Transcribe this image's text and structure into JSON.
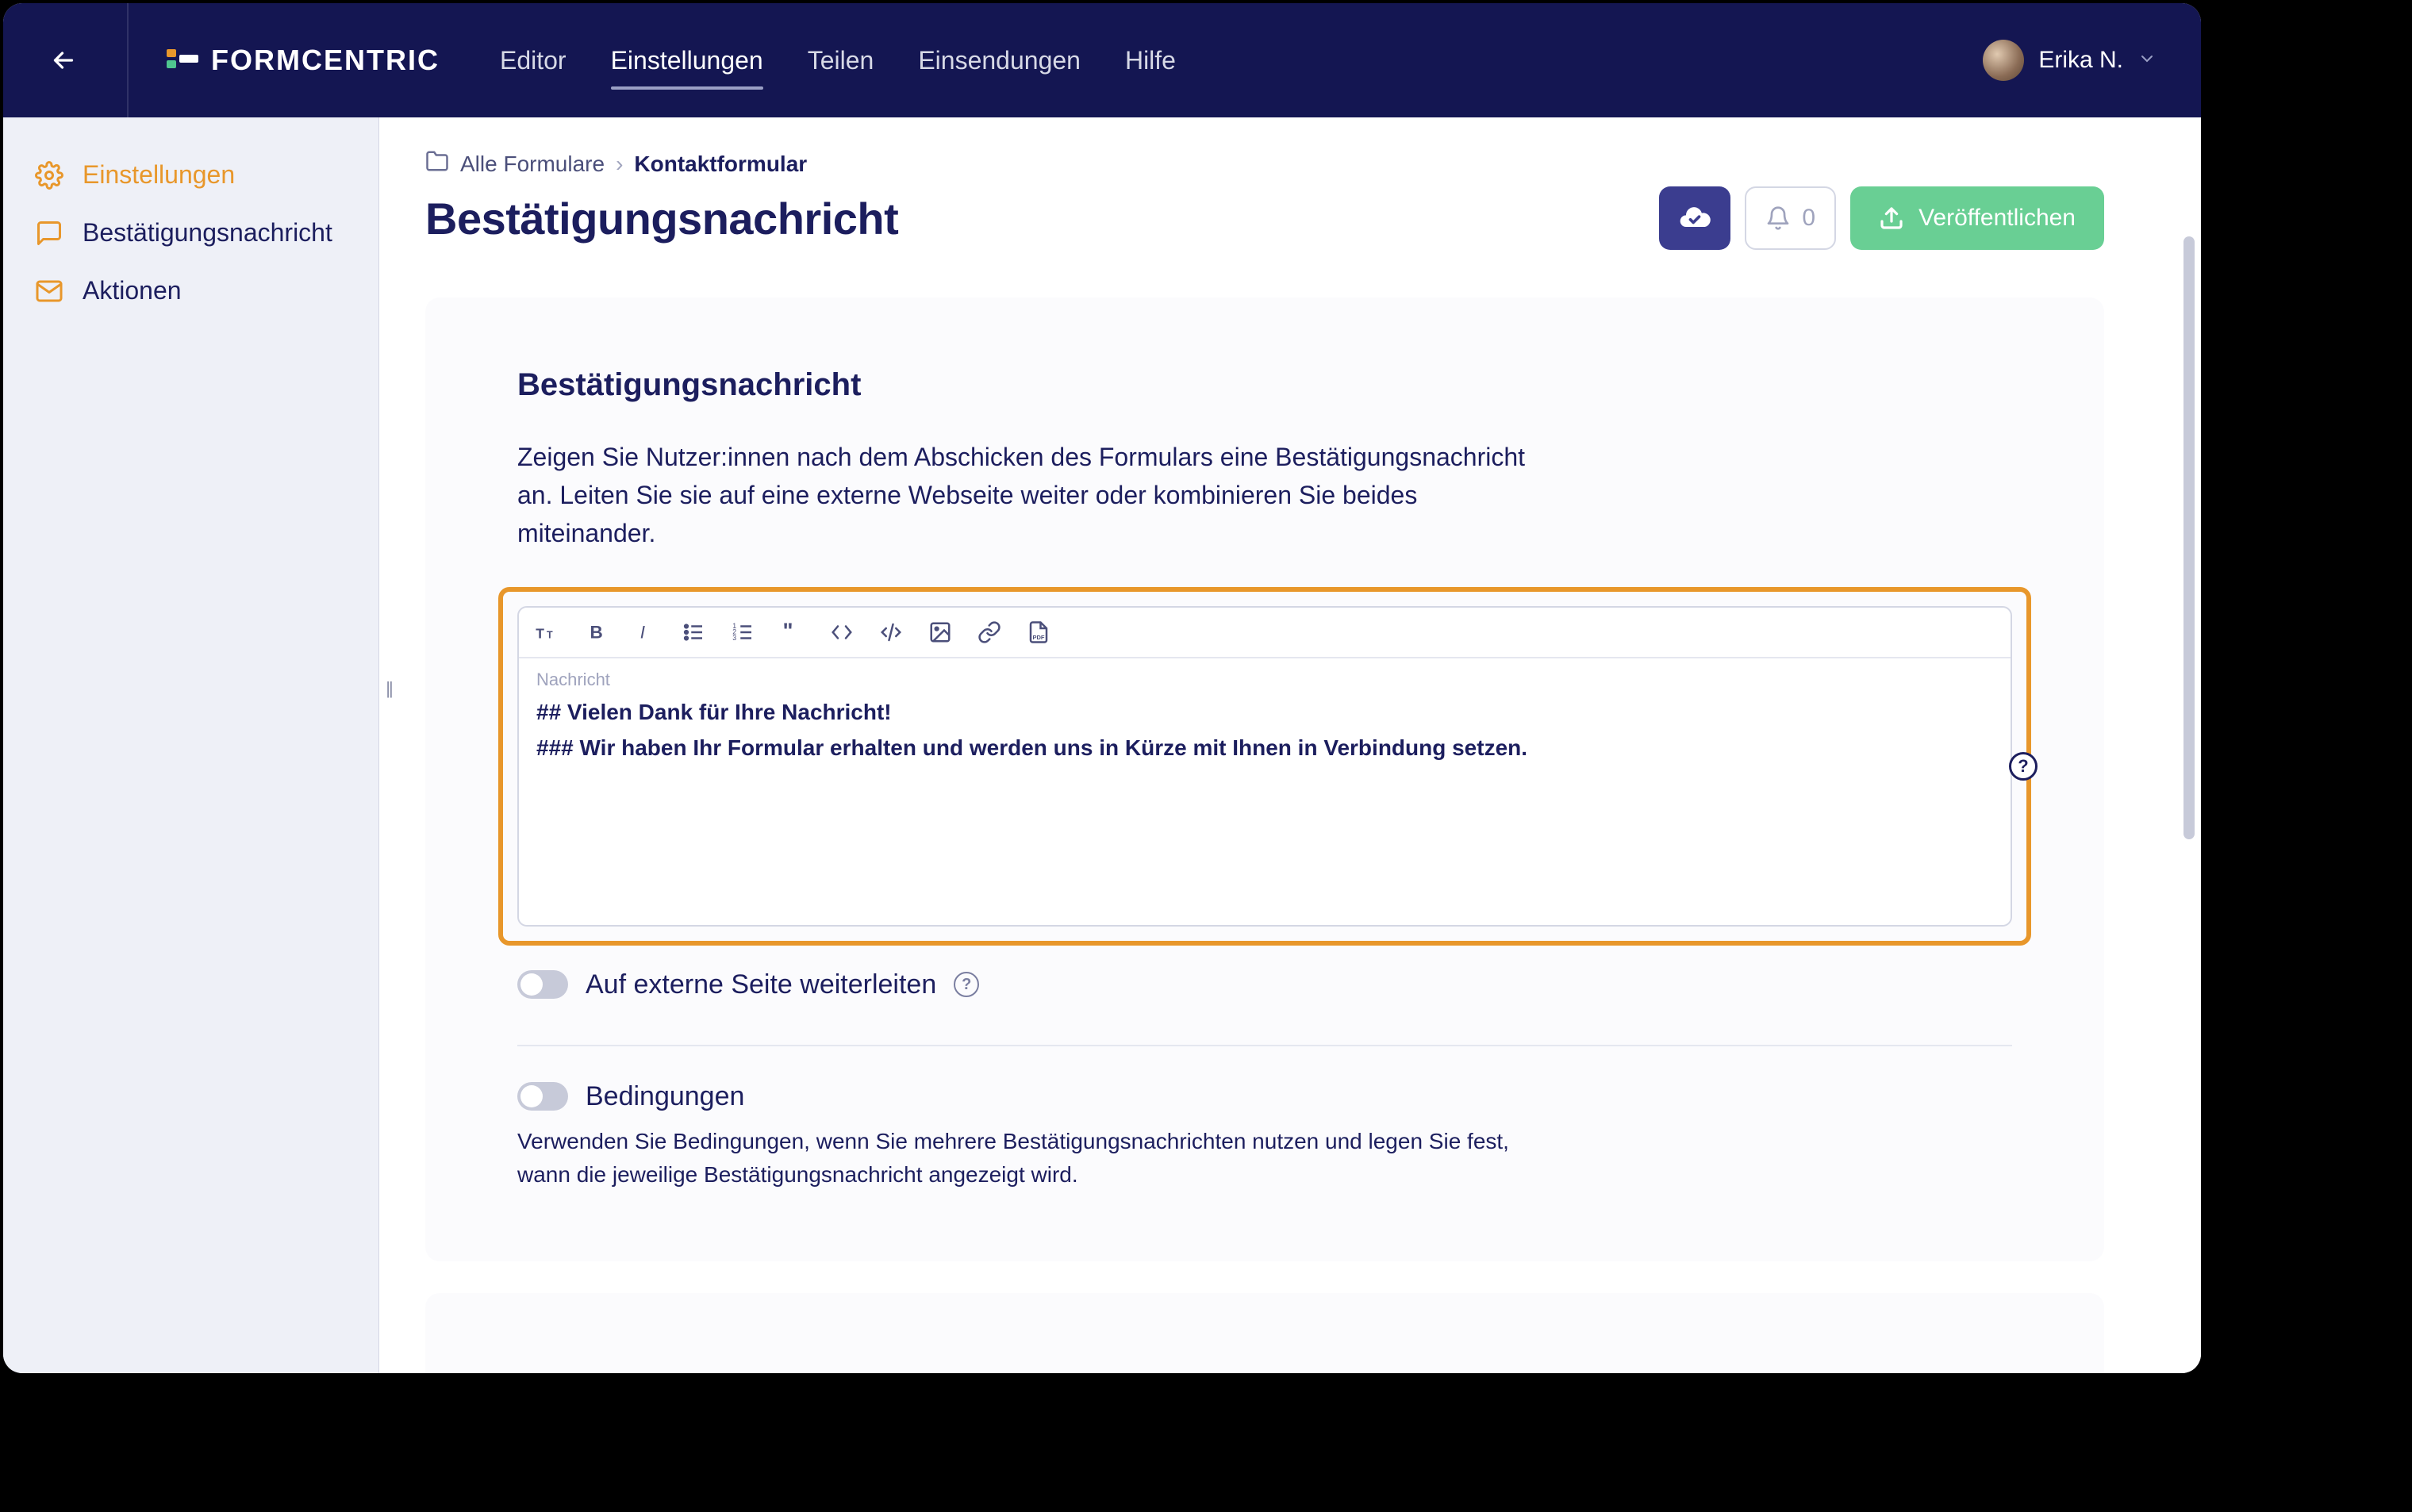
{
  "brand": "FORMCENTRIC",
  "nav": {
    "editor": "Editor",
    "settings": "Einstellungen",
    "share": "Teilen",
    "submissions": "Einsendungen",
    "help": "Hilfe"
  },
  "user": {
    "name": "Erika N."
  },
  "sidebar": {
    "settings": "Einstellungen",
    "confirmation": "Bestätigungsnachricht",
    "actions": "Aktionen"
  },
  "breadcrumb": {
    "all_forms": "Alle Formulare",
    "current": "Kontaktformular"
  },
  "page_title": "Bestätigungsnachricht",
  "header_actions": {
    "notification_count": "0",
    "publish": "Veröffentlichen"
  },
  "card": {
    "title": "Bestätigungsnachricht",
    "description": "Zeigen Sie Nutzer:innen nach dem Abschicken des Formulars eine Bestätigungsnachricht an. Leiten Sie sie auf eine externe Webseite weiter oder kombinieren Sie beides miteinander.",
    "editor_label": "Nachricht",
    "editor_line1": "## Vielen Dank für Ihre Nachricht!",
    "editor_line2": "### Wir haben Ihr Formular erhalten und werden uns in Kürze mit Ihnen in Verbindung setzen.",
    "redirect_label": "Auf externe Seite weiterleiten",
    "conditions_label": "Bedingungen",
    "conditions_desc": "Verwenden Sie Bedingungen, wenn Sie mehrere Bestätigungsnachrichten nutzen und legen Sie fest, wann die jeweilige Bestätigungsnachricht angezeigt wird."
  }
}
